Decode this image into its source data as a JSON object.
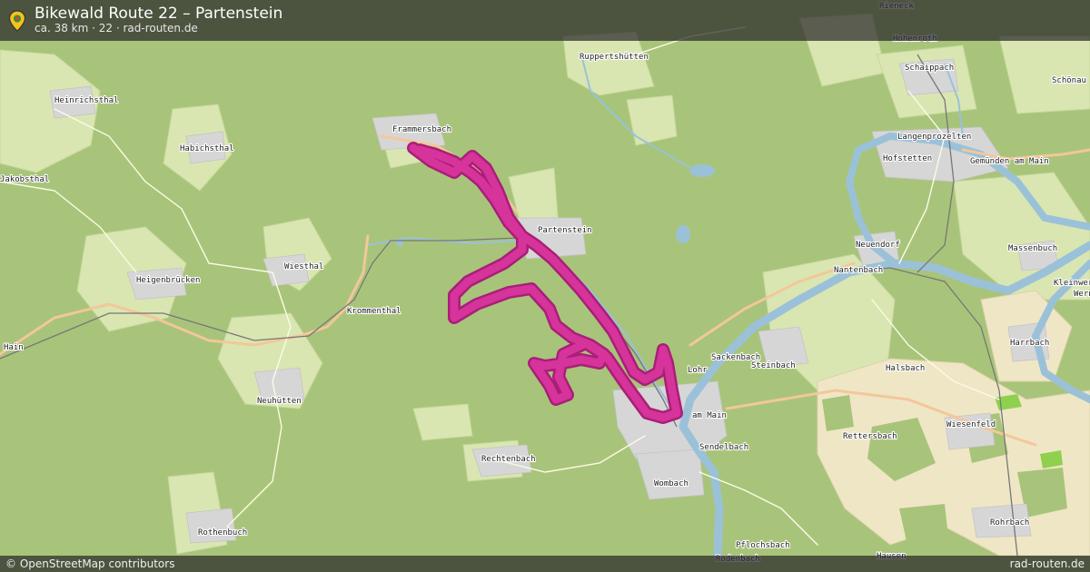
{
  "header": {
    "title": "Bikewald Route 22 – Partenstein",
    "subtitle": "ca. 38 km · 22 · rad-routen.de",
    "pin_icon": "map-pin-icon"
  },
  "footer": {
    "attribution": "© OpenStreetMap contributors",
    "site": "rad-routen.de"
  },
  "colors": {
    "route": "#d6339b",
    "route_outline": "#a81f78",
    "forest": "#a8c47a",
    "field": "#d8e6b0",
    "settlement": "#dedede",
    "river": "#9bc1d9",
    "road_main": "#f6c99b",
    "road_minor": "#f2e7a6"
  },
  "places": [
    {
      "name": "Rieneck"
    },
    {
      "name": "Hohenroth"
    },
    {
      "name": "Schaippach"
    },
    {
      "name": "Schönau"
    },
    {
      "name": "Ruppertshütten"
    },
    {
      "name": "Heinrichsthal"
    },
    {
      "name": "Frammersbach"
    },
    {
      "name": "Habichsthal"
    },
    {
      "name": "Langenprozelten"
    },
    {
      "name": "Hofstetten"
    },
    {
      "name": "Gemünden am Main"
    },
    {
      "name": "Jakobsthal"
    },
    {
      "name": "Partenstein"
    },
    {
      "name": "Neuendorf"
    },
    {
      "name": "Massenbuch"
    },
    {
      "name": "Wiesthal"
    },
    {
      "name": "Nantenbach"
    },
    {
      "name": "Heigenbrücken"
    },
    {
      "name": "Kleinwern"
    },
    {
      "name": "Wern"
    },
    {
      "name": "Krommenthal"
    },
    {
      "name": "Hain"
    },
    {
      "name": "Sackenbach"
    },
    {
      "name": "Steinbach"
    },
    {
      "name": "Halsbach"
    },
    {
      "name": "Harrbach"
    },
    {
      "name": "Neuhütten"
    },
    {
      "name": "Lohr"
    },
    {
      "name": "am Main"
    },
    {
      "name": "Rettersbach"
    },
    {
      "name": "Wiesenfeld"
    },
    {
      "name": "Sendelbach"
    },
    {
      "name": "Rechtenbach"
    },
    {
      "name": "Wombach"
    },
    {
      "name": "Rothenbuch"
    },
    {
      "name": "Rohrbach"
    },
    {
      "name": "Pflochsbach"
    },
    {
      "name": "Rodenbach"
    },
    {
      "name": "Hausen"
    }
  ]
}
